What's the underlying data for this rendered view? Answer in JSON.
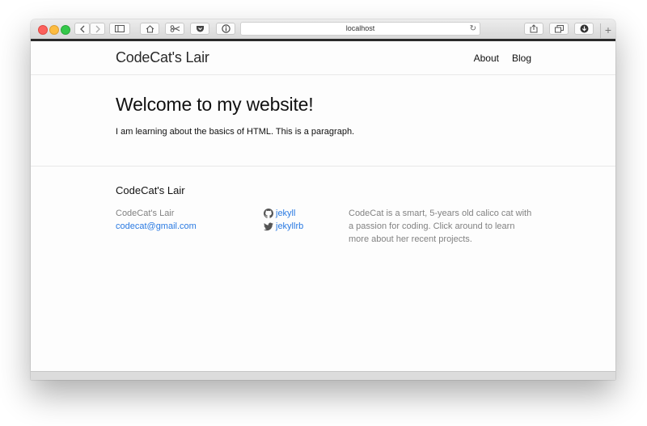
{
  "browser": {
    "url": "localhost",
    "newtab_label": "+"
  },
  "header": {
    "site_title": "CodeCat's Lair",
    "nav": [
      "About",
      "Blog"
    ]
  },
  "main": {
    "heading": "Welcome to my website!",
    "paragraph": "I am learning about the basics of HTML. This is a paragraph."
  },
  "footer": {
    "title": "CodeCat's Lair",
    "name": "CodeCat's Lair",
    "email": "codecat@gmail.com",
    "github": "jekyll",
    "twitter": "jekyllrb",
    "description": "CodeCat is a smart, 5-years old calico cat with a passion for coding. Click around to learn more about her recent projects."
  }
}
